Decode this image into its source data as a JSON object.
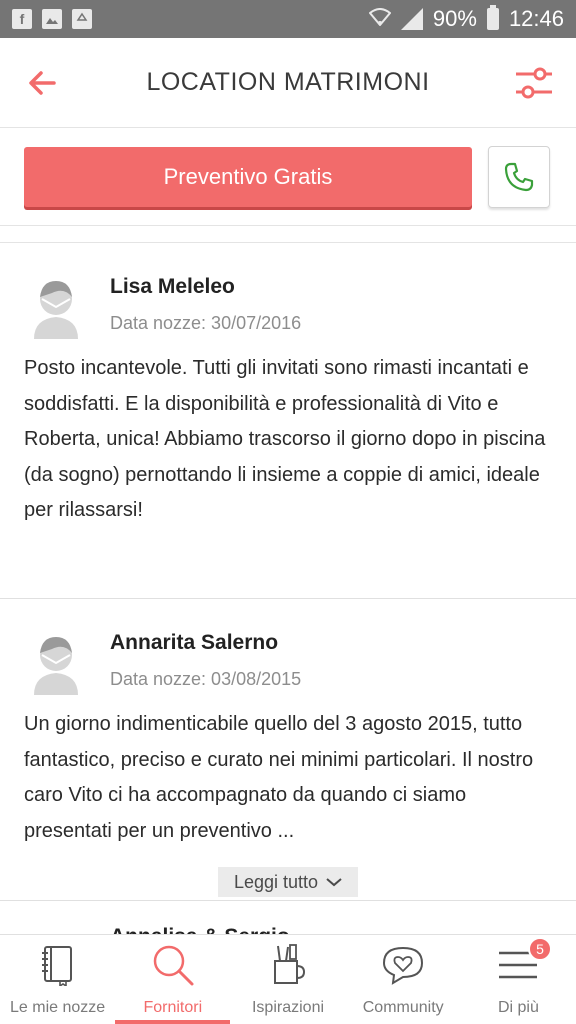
{
  "status_bar": {
    "battery": "90%",
    "time": "12:46",
    "icons": [
      "facebook-icon",
      "image-icon",
      "recycle-icon",
      "wifi-icon",
      "signal-icon",
      "battery-icon"
    ]
  },
  "header": {
    "title": "LOCATION MATRIMONI",
    "back_icon": "arrow-left-icon",
    "filter_icon": "sliders-icon"
  },
  "cta": {
    "primary_label": "Preventivo Gratis",
    "phone_icon": "phone-icon"
  },
  "reviews": [
    {
      "name": "Lisa Meleleo",
      "date": "Data nozze: 30/07/2016",
      "text": "Posto incantevole. Tutti gli invitati sono rimasti incantati e soddisfatti. E la disponibilità e professionalità di Vito e Roberta, unica! Abbiamo trascorso il giorno dopo in piscina (da sogno) pernottando li insieme a coppie di amici, ideale per rilassarsi!"
    },
    {
      "name": "Annarita Salerno",
      "date": "Data nozze: 03/08/2015",
      "text": "Un giorno indimenticabile quello del 3 agosto 2015, tutto fantastico, preciso e curato nei minimi particolari. Il nostro caro Vito ci ha accompagnato da quando ci siamo presentati per un preventivo ...",
      "read_more": "Leggi tutto"
    },
    {
      "name": "Annalisa & Sergio"
    }
  ],
  "bottom_nav": {
    "items": [
      {
        "label": "Le mie nozze",
        "icon": "notebook-icon"
      },
      {
        "label": "Fornitori",
        "icon": "search-icon"
      },
      {
        "label": "Ispirazioni",
        "icon": "tools-cup-icon"
      },
      {
        "label": "Community",
        "icon": "heart-chat-icon"
      },
      {
        "label": "Di più",
        "icon": "menu-icon"
      }
    ],
    "active": "Fornitori",
    "badge": "5"
  },
  "colors": {
    "accent": "#f26b6b",
    "status_bar": "#757575",
    "phone_green": "#3aa03a"
  }
}
